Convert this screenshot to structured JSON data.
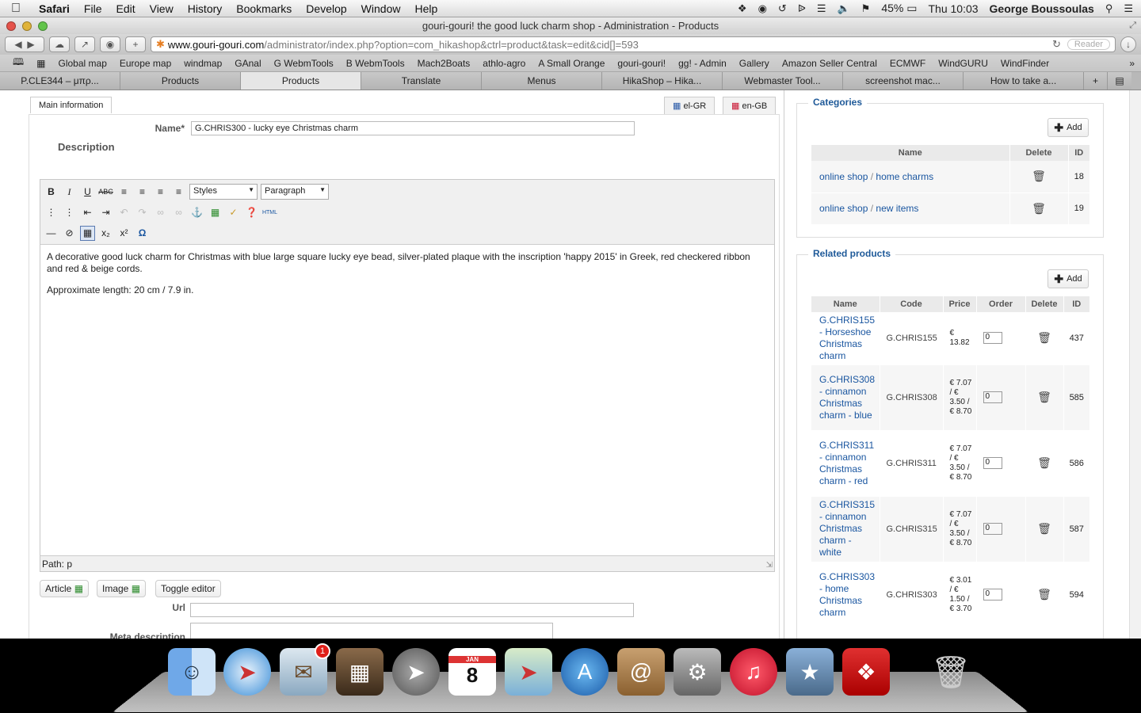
{
  "menubar": {
    "apple": "",
    "app": "Safari",
    "items": [
      "File",
      "Edit",
      "View",
      "History",
      "Bookmarks",
      "Develop",
      "Window",
      "Help"
    ],
    "battery": "45%",
    "clock": "Thu 10:03",
    "user": "George Boussoulas"
  },
  "window": {
    "title": "gouri-gouri! the good luck charm shop - Administration - Products"
  },
  "toolbar": {
    "url_domain": "www.gouri-gouri.com",
    "url_rest": "/administrator/index.php?option=com_hikashop&ctrl=product&task=edit&cid[]=593",
    "reader": "Reader"
  },
  "bookmarks": [
    "Global map",
    "Europe map",
    "windmap",
    "GAnal",
    "G WebmTools",
    "B WebmTools",
    "Mach2Boats",
    "athlo-agro",
    "A Small Orange",
    "gouri-gouri!",
    "gg! - Admin",
    "Gallery",
    "Amazon Seller Central",
    "ECMWF",
    "WindGURU",
    "WindFinder"
  ],
  "tabs": [
    "P.CLE344 – μπρ...",
    "Products",
    "Products",
    "Translate",
    "Menus",
    "HikaShop – Hika...",
    "Webmaster Tool...",
    "screenshot mac...",
    "How to take a..."
  ],
  "form": {
    "main_tab": "Main information",
    "lang1": "el-GR",
    "lang2": "en-GB",
    "name_label": "Name*",
    "name_value": "G.CHRIS300 - lucky eye Christmas charm",
    "description_label": "Description",
    "styles": "Styles",
    "paragraph": "Paragraph",
    "body_p1": "A decorative good luck charm for Christmas with blue large square lucky eye bead, silver-plated plaque with the inscription 'happy 2015' in Greek, red checkered ribbon and red & beige cords.",
    "body_p2": "Approximate length:  20 cm / 7.9 in.",
    "path": "Path: p",
    "btn_article": "Article",
    "btn_image": "Image",
    "btn_toggle": "Toggle editor",
    "url_label": "Url",
    "meta_label": "Meta description"
  },
  "categories": {
    "legend": "Categories",
    "add": "Add",
    "headers": [
      "Name",
      "Delete",
      "ID"
    ],
    "rows": [
      {
        "path1": "online shop",
        "sep": " / ",
        "path2": "home charms",
        "id": "18"
      },
      {
        "path1": "online shop",
        "sep": " / ",
        "path2": "new items",
        "id": "19"
      }
    ]
  },
  "related": {
    "legend": "Related products",
    "add": "Add",
    "headers": [
      "Name",
      "Code",
      "Price",
      "Order",
      "Delete",
      "ID"
    ],
    "rows": [
      {
        "name": "G.CHRIS155 - Horseshoe Christmas charm",
        "code": "G.CHRIS155",
        "price": "€ 13.82",
        "order": "0",
        "id": "437"
      },
      {
        "name": "G.CHRIS308 - cinnamon Christmas charm - blue",
        "code": "G.CHRIS308",
        "price": "€ 7.07 / € 3.50 / € 8.70",
        "order": "0",
        "id": "585"
      },
      {
        "name": "G.CHRIS311 - cinnamon Christmas charm - red",
        "code": "G.CHRIS311",
        "price": "€ 7.07 / € 3.50 / € 8.70",
        "order": "0",
        "id": "586"
      },
      {
        "name": "G.CHRIS315 - cinnamon Christmas charm - white",
        "code": "G.CHRIS315",
        "price": "€ 7.07 / € 3.50 / € 8.70",
        "order": "0",
        "id": "587"
      },
      {
        "name": "G.CHRIS303 - home Christmas charm",
        "code": "G.CHRIS303",
        "price": "€ 3.01 / € 1.50 / € 3.70",
        "order": "0",
        "id": "594"
      }
    ]
  },
  "dock": {
    "calendar_month": "JAN",
    "calendar_day": "8",
    "mail_badge": "1"
  }
}
